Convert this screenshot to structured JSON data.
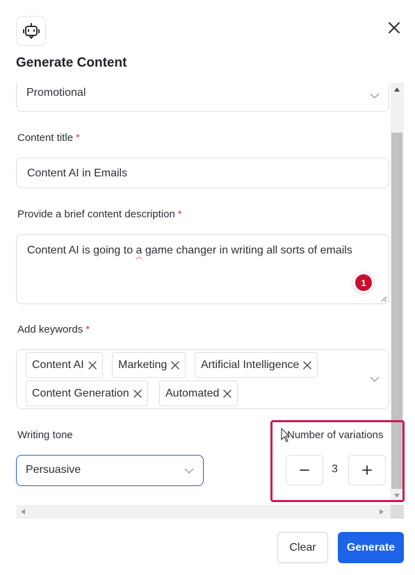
{
  "header": {
    "logo_icon": "robot-icon",
    "close_icon": "close-icon",
    "title": "Generate Content"
  },
  "form": {
    "content_type": {
      "value": "Promotional"
    },
    "content_title": {
      "label": "Content title",
      "required_mark": "*",
      "value": "Content AI in Emails"
    },
    "description": {
      "label": "Provide a brief content description",
      "required_mark": "*",
      "value_before": "Content AI is going to ",
      "value_flagged": "a",
      "value_after": " game changer in writing all sorts of emails",
      "issue_count": "1"
    },
    "keywords": {
      "label": "Add keywords",
      "required_mark": "*",
      "tags": [
        "Content AI",
        "Marketing",
        "Artificial Intelligence",
        "Content Generation",
        "Automated"
      ]
    },
    "writing_tone": {
      "label": "Writing tone",
      "value": "Persuasive"
    },
    "variations": {
      "label": "Number of variations",
      "value": "3",
      "minus": "−",
      "plus": "+"
    }
  },
  "footer": {
    "clear_label": "Clear",
    "generate_label": "Generate"
  },
  "colors": {
    "accent": "#1d63e8",
    "required": "#d33b3b",
    "highlight": "#d0185a",
    "badge": "#c8102e"
  }
}
